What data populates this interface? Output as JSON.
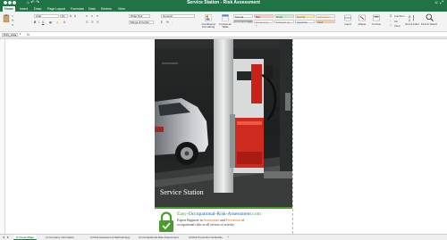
{
  "window": {
    "title": "Service Station - Risk Assessment",
    "quick_access": "⌂ ↶ ↷",
    "right_icons": "☺ ⤢"
  },
  "ribbon_tabs": [
    "Home",
    "Insert",
    "Draw",
    "Page Layout",
    "Formulas",
    "Data",
    "Review",
    "View"
  ],
  "active_tab": "Home",
  "ribbon": {
    "font_name": "Arial",
    "font_size": "10",
    "wrap_text": "Wrap Text",
    "merge_center": "Merge & Center",
    "number_format": "General",
    "conditional_formatting": "Conditional Formatting",
    "format_as_table": "Format as Table",
    "styles": [
      {
        "label": "Normal",
        "bg": "#ffffff",
        "color": "#222222"
      },
      {
        "label": "Bad",
        "bg": "#ffc7ce",
        "color": "#9c0006"
      },
      {
        "label": "Good",
        "bg": "#c6efce",
        "color": "#006100"
      },
      {
        "label": "Neutral",
        "bg": "#ffeb9c",
        "color": "#9c5700"
      },
      {
        "label": "Calculation",
        "bg": "#f2f2f2",
        "color": "#fa7d00"
      },
      {
        "label": "Check Cell",
        "bg": "#a5a5a5",
        "color": "#ffffff"
      },
      {
        "label": "Explanatory T...",
        "bg": "#ffffff",
        "color": "#7f7f7f"
      },
      {
        "label": "Followed Hy...",
        "bg": "#ffffff",
        "color": "#954f72"
      },
      {
        "label": "Hyperlink",
        "bg": "#ffffff",
        "color": "#0563c1"
      },
      {
        "label": "Input",
        "bg": "#ffcc99",
        "color": "#3f3f76"
      }
    ],
    "insert": "Insert",
    "delete": "Delete",
    "format": "Format",
    "autosum": "AutoSum",
    "fill": "Fill",
    "clear": "Clear",
    "sort_filter": "Sort & Filter",
    "find_select": "Find & Select"
  },
  "formula_bar": {
    "name_box": "Print_Area",
    "fx": "fx",
    "value": ""
  },
  "cover": {
    "title": "Service Station",
    "brand_part1": "Easy-",
    "brand_part2": "Occupational-Risk-Assessment",
    "brand_part3": ".com",
    "tagline1_a": "Expert Engineer in ",
    "tagline1_b": "Assessment",
    "tagline1_c": " and ",
    "tagline1_d": "Prevention",
    "tagline1_e": " of",
    "tagline2": "occupational risks in all sectors of activity"
  },
  "sheet_tabs": [
    "0. Cover Page",
    "1) Company information",
    "2) Risk Assessment Methodology",
    "3) Occupational Risk Assessment",
    "4) Risk Prevention Schedule"
  ],
  "active_sheet": "0. Cover Page",
  "colors": {
    "excel_green": "#217346",
    "brand_blue": "#1d5ea8",
    "brand_green": "#4c9b2d",
    "brand_orange": "#d66a13"
  }
}
